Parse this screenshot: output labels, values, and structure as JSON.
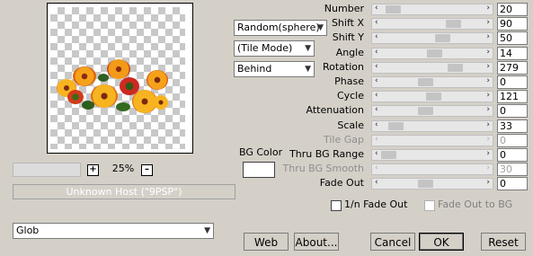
{
  "preview": {
    "zoom_out_label": "+",
    "zoom_level": "25%",
    "zoom_in_label": "–"
  },
  "status": "Unknown Host (\"9PSP\")",
  "dropdowns": {
    "distribution": "Random(sphere)",
    "mode": "(Tile Mode)",
    "placement": "Behind",
    "preset": "Glob"
  },
  "bg_color": {
    "label": "BG Color",
    "value": "#ffffff"
  },
  "params": [
    {
      "label": "Number",
      "value": "20",
      "fraction": 0.05,
      "enabled": true
    },
    {
      "label": "Shift X",
      "value": "90",
      "fraction": 0.74,
      "enabled": true
    },
    {
      "label": "Shift Y",
      "value": "50",
      "fraction": 0.62,
      "enabled": true
    },
    {
      "label": "Angle",
      "value": "14",
      "fraction": 0.53,
      "enabled": true
    },
    {
      "label": "Rotation",
      "value": "279",
      "fraction": 0.76,
      "enabled": true
    },
    {
      "label": "Phase",
      "value": "0",
      "fraction": 0.42,
      "enabled": true
    },
    {
      "label": "Cycle",
      "value": "121",
      "fraction": 0.52,
      "enabled": true
    },
    {
      "label": "Attenuation",
      "value": "0",
      "fraction": 0.42,
      "enabled": true
    },
    {
      "label": "Scale",
      "value": "33",
      "fraction": 0.08,
      "enabled": true
    },
    {
      "label": "Tile Gap",
      "value": "0",
      "fraction": 0.0,
      "enabled": false
    },
    {
      "label": "Thru BG Range",
      "value": "0",
      "fraction": 0.0,
      "enabled": true
    },
    {
      "label": "Thru BG Smooth",
      "value": "30",
      "fraction": 0.0,
      "enabled": false
    },
    {
      "label": "Fade Out",
      "value": "0",
      "fraction": 0.42,
      "enabled": true
    }
  ],
  "checkboxes": {
    "fade_1n": {
      "label": "1/n Fade Out",
      "checked": false
    },
    "fade_bg": {
      "label": "Fade Out to BG",
      "checked": false
    }
  },
  "buttons": {
    "web": "Web",
    "about": "About...",
    "cancel": "Cancel",
    "ok": "OK",
    "reset": "Reset"
  }
}
